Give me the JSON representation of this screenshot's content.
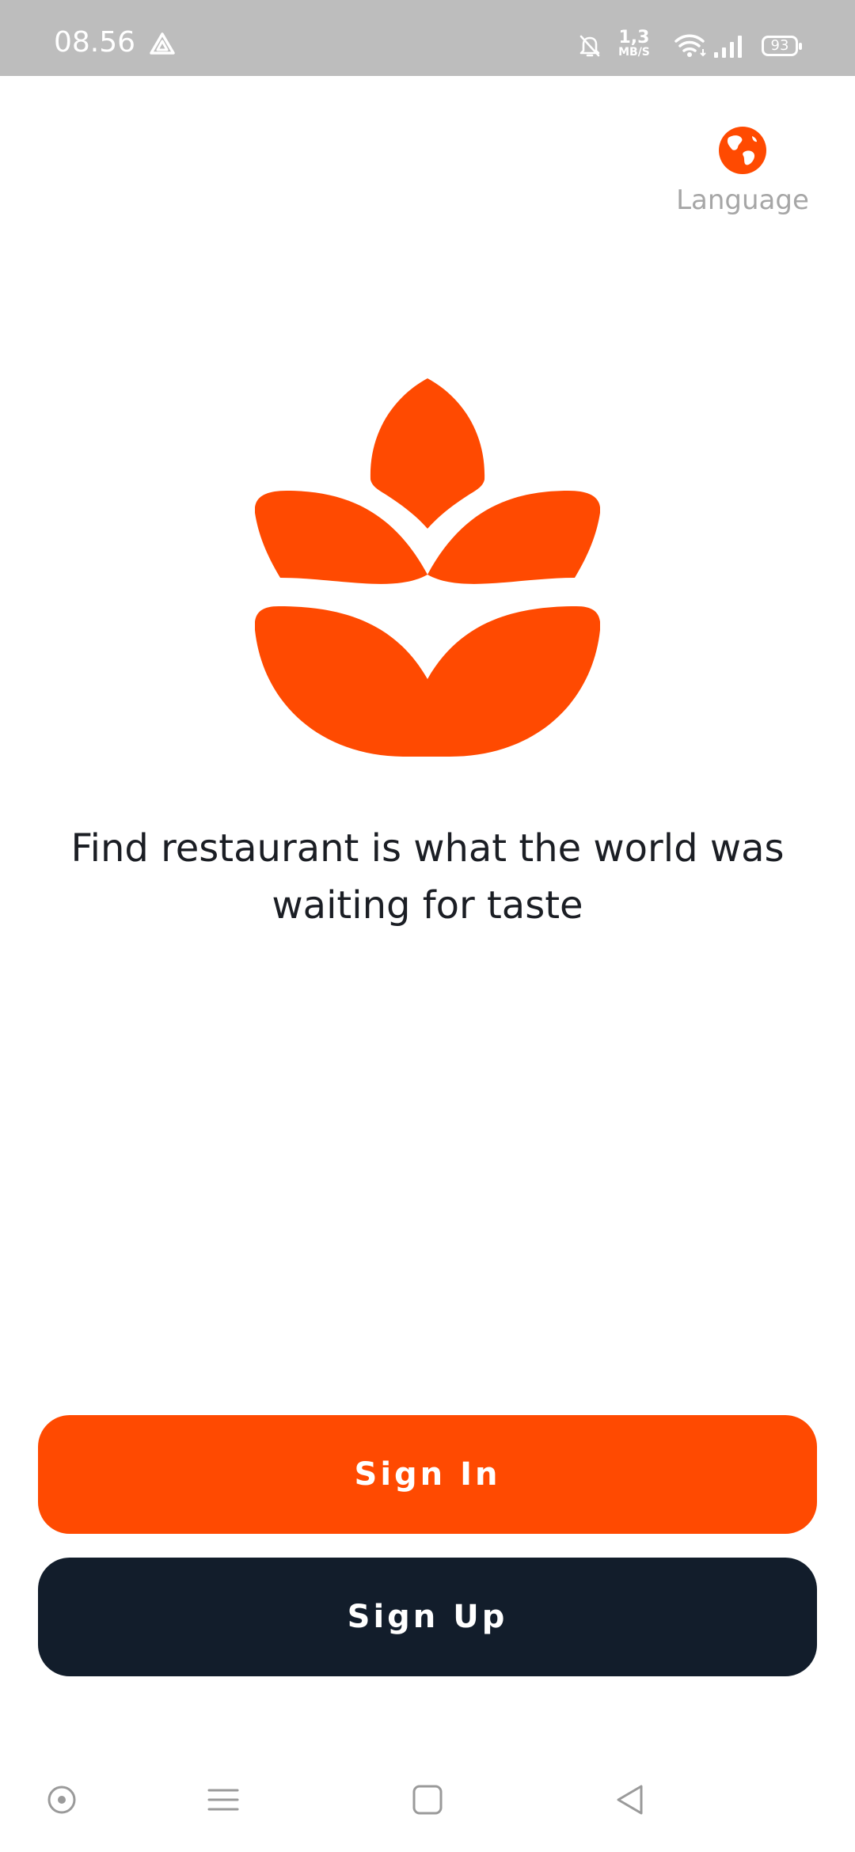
{
  "status_bar": {
    "time": "08.56",
    "speed_value": "1,3",
    "speed_unit": "MB/S",
    "battery": "93",
    "icons": [
      "drive-icon",
      "bell-off-icon",
      "wifi-icon",
      "signal-icon",
      "battery-icon"
    ]
  },
  "language": {
    "label": "Language",
    "icon": "globe-icon"
  },
  "brand": {
    "accent": "#ff4a01",
    "dark": "#121d2b",
    "logo": "leaf-logo-icon"
  },
  "tagline": "Find restaurant is what the world was waiting for taste",
  "buttons": {
    "sign_in": "Sign In",
    "sign_up": "Sign Up"
  },
  "nav_bar": {
    "icons": [
      "circle-dot-icon",
      "menu-icon",
      "home-square-icon",
      "back-triangle-icon"
    ]
  }
}
